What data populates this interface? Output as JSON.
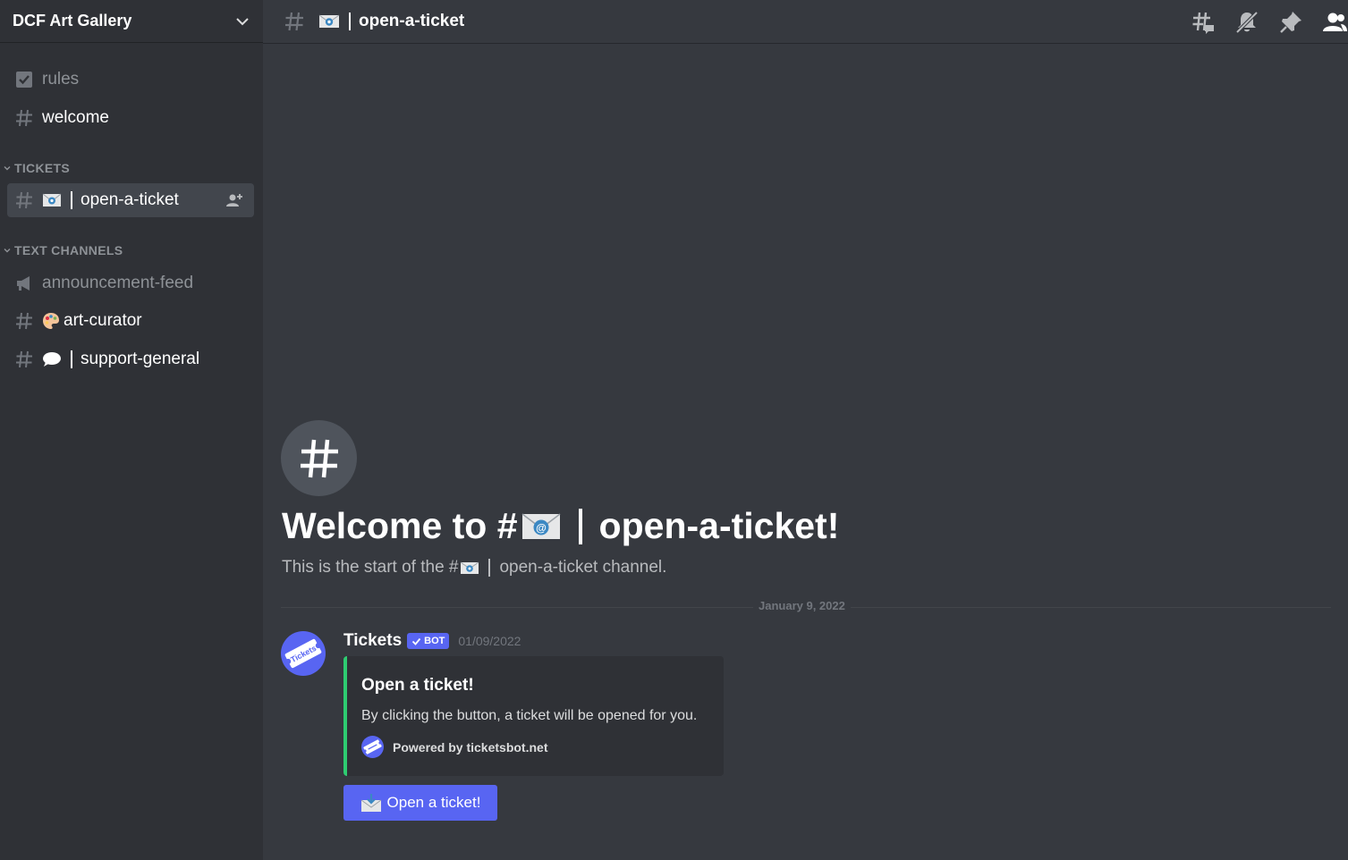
{
  "server": {
    "name": "DCF Art Gallery",
    "menu_icon": "chevron-down-icon"
  },
  "sidebar": {
    "top_channels": [
      {
        "label": "rules",
        "icon": "rules-checkbox-icon"
      },
      {
        "label": "welcome",
        "icon": "hash-icon"
      }
    ],
    "categories": [
      {
        "label": "TICKETS",
        "channels": [
          {
            "label": "open-a-ticket",
            "emoji": "envelope-icon",
            "selected": true
          }
        ]
      },
      {
        "label": "TEXT CHANNELS",
        "channels": [
          {
            "label": "announcement-feed",
            "icon": "megaphone-icon"
          },
          {
            "label": "art-curator",
            "emoji": "palette-icon"
          },
          {
            "label": "support-general",
            "emoji": "speech-bubble-icon"
          }
        ]
      }
    ]
  },
  "header": {
    "channel_name": "open-a-ticket",
    "tools": [
      "threads-icon",
      "notification-mute-icon",
      "pin-icon",
      "members-icon"
    ]
  },
  "welcome": {
    "title_prefix": "Welcome to #",
    "title_channel": "open-a-ticket!",
    "subtitle_prefix": "This is the start of the #",
    "subtitle_suffix": "open-a-ticket channel."
  },
  "divider": {
    "date": "January 9, 2022"
  },
  "message": {
    "author": "Tickets",
    "bot_tag": "BOT",
    "timestamp": "01/09/2022",
    "avatar_text": "Tickets",
    "embed": {
      "accent_color": "#2ecc71",
      "title": "Open a ticket!",
      "description": "By clicking the button, a ticket will be opened for you.",
      "footer": "Powered by ticketsbot.net"
    },
    "button": {
      "label": "Open a ticket!",
      "emoji": "envelope-incoming-icon",
      "color": "#5865f2"
    }
  },
  "colors": {
    "background": "#36393f",
    "sidebar": "#2f3136",
    "blurple": "#5865f2"
  }
}
